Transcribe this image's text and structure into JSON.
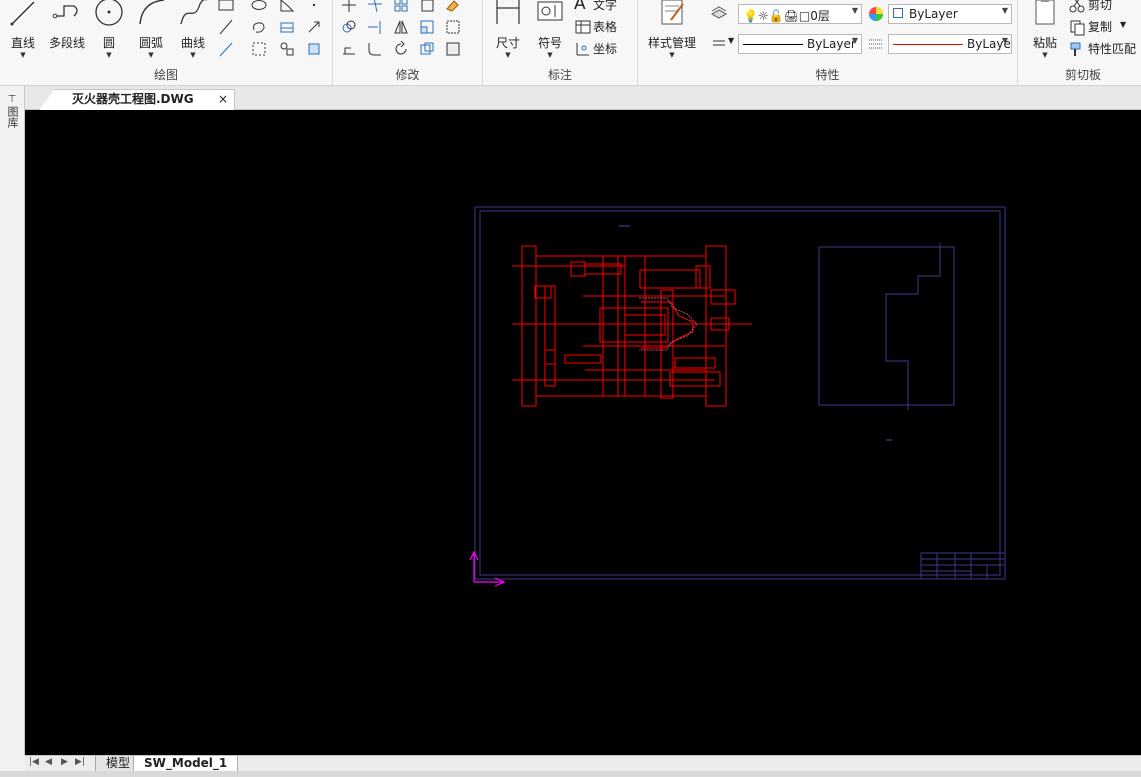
{
  "ribbon": {
    "draw": {
      "title": "绘图",
      "line": "直线",
      "polyline": "多段线",
      "circle": "圆",
      "arc": "圆弧",
      "curve": "曲线"
    },
    "modify": {
      "title": "修改"
    },
    "annotate": {
      "title": "标注",
      "dimension": "尺寸",
      "symbol": "符号",
      "text": "文字",
      "table": "表格",
      "coordinate": "坐标"
    },
    "properties": {
      "title": "特性",
      "style_manager": "样式管理",
      "layer": "0层",
      "color": "ByLayer",
      "linetype": "ByLayer",
      "lineweight": "ByLayer"
    },
    "clipboard": {
      "title": "剪切板",
      "paste": "粘贴",
      "cut": "剪切",
      "copy": "复制",
      "match_props": "特性匹配"
    }
  },
  "side_tab": {
    "label": "图库"
  },
  "document": {
    "tab_name": "灭火器壳工程图.DWG",
    "close": "×"
  },
  "layouts": {
    "tabs": [
      "模型",
      "SW_Model_1"
    ],
    "active": "SW_Model_1"
  },
  "colors": {
    "canvas": "#000000",
    "drawing": "#ff0000",
    "frame": "#3a3a8c",
    "ucs": "#ff00ff"
  }
}
